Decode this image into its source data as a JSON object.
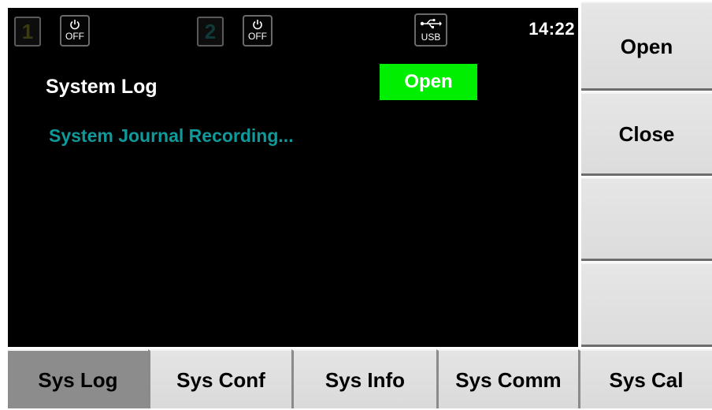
{
  "status_bar": {
    "channel1": {
      "number": "1",
      "power_state": "OFF"
    },
    "channel2": {
      "number": "2",
      "power_state": "OFF"
    },
    "usb_label": "USB",
    "time": "14:22",
    "icons": {
      "power": "power-icon",
      "usb": "usb-icon"
    }
  },
  "main": {
    "title": "System Log",
    "state": "Open",
    "message": "System Journal Recording..."
  },
  "softkeys": [
    {
      "label": "Open"
    },
    {
      "label": "Close"
    },
    {
      "label": ""
    },
    {
      "label": ""
    }
  ],
  "tabs": [
    {
      "label": "Sys Log",
      "active": true
    },
    {
      "label": "Sys Conf",
      "active": false
    },
    {
      "label": "Sys Info",
      "active": false
    },
    {
      "label": "Sys Comm",
      "active": false
    },
    {
      "label": "Sys Cal",
      "active": false
    }
  ],
  "colors": {
    "screen_bg": "#000000",
    "state_badge": "#00ee00",
    "message_text": "#0e9a9a",
    "softkey_bg": "#e0e0e0",
    "active_tab_bg": "#8c8c8c"
  }
}
